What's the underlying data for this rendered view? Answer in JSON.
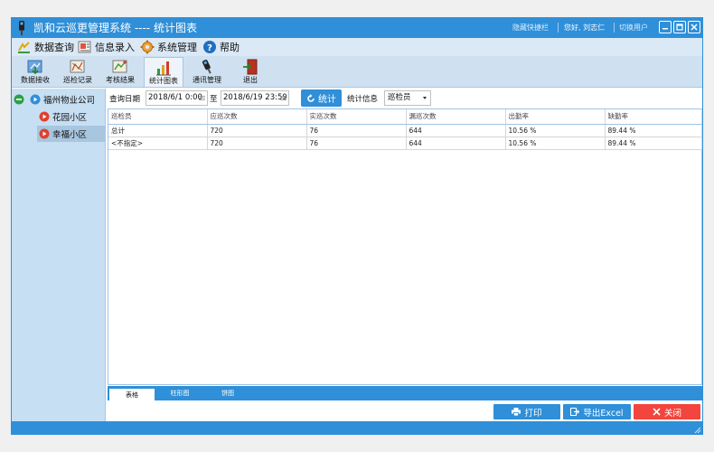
{
  "window": {
    "title": "凯和云巡更管理系统 ---- 统计图表",
    "hide_shortcut": "隐藏快捷栏",
    "greeting": "您好, 刘志仁",
    "switch_user": "切换用户"
  },
  "menu": {
    "items": [
      {
        "label": "数据查询",
        "icon": "pencil-check-icon"
      },
      {
        "label": "信息录入",
        "icon": "photo-card-icon"
      },
      {
        "label": "系统管理",
        "icon": "gear-icon"
      },
      {
        "label": "帮助",
        "icon": "help-icon"
      }
    ]
  },
  "toolbar": {
    "items": [
      {
        "label": "数据接收",
        "icon": "map-download-icon"
      },
      {
        "label": "巡检记录",
        "icon": "map-route-icon"
      },
      {
        "label": "考核结果",
        "icon": "map-check-icon"
      },
      {
        "label": "统计图表",
        "icon": "bar-chart-icon"
      },
      {
        "label": "通讯管理",
        "icon": "reader-device-icon"
      },
      {
        "label": "退出",
        "icon": "exit-door-icon"
      }
    ]
  },
  "tree": {
    "root": "福州物业公司",
    "children": [
      "花园小区",
      "幸福小区"
    ],
    "selected": "幸福小区"
  },
  "filter": {
    "date_label": "查询日期",
    "start_date": "2018/6/1 0:00",
    "to_label": "至",
    "end_date": "2018/6/19 23:59",
    "stat_button": "统计",
    "info_label": "统计信息",
    "info_value": "巡检员"
  },
  "grid": {
    "headers": [
      "巡检员",
      "应巡次数",
      "实巡次数",
      "漏巡次数",
      "出勤率",
      "缺勤率"
    ],
    "rows": [
      [
        "总计",
        "720",
        "76",
        "644",
        "10.56 %",
        "89.44 %"
      ],
      [
        "<不指定>",
        "720",
        "76",
        "644",
        "10.56 %",
        "89.44 %"
      ]
    ]
  },
  "tabs": [
    "表格",
    "柱形图",
    "饼图"
  ],
  "buttons": {
    "print": "打印",
    "export": "导出Excel",
    "close": "关闭"
  },
  "colors": {
    "accent": "#2f8fd8",
    "close": "#f2453d"
  }
}
